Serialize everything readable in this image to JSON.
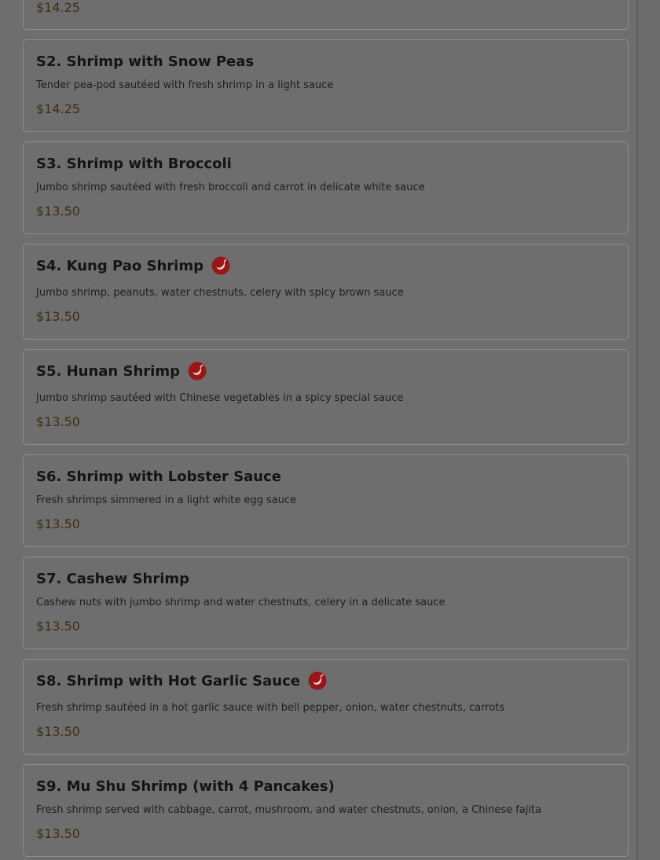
{
  "menu": {
    "items": [
      {
        "price": "$14.25"
      },
      {
        "name": "S2. Shrimp with Snow Peas",
        "description": "Tender pea-pod sautéed with fresh shrimp in a light sauce",
        "price": "$14.25",
        "spicy": false
      },
      {
        "name": "S3. Shrimp with Broccoli",
        "description": "Jumbo shrimp sautéed with fresh broccoli and carrot in delicate white sauce",
        "price": "$13.50",
        "spicy": false
      },
      {
        "name": "S4. Kung Pao Shrimp",
        "description": "Jumbo shrimp, peanuts, water chestnuts, celery with spicy brown sauce",
        "price": "$13.50",
        "spicy": true
      },
      {
        "name": "S5. Hunan Shrimp",
        "description": "Jumbo shrimp sautéed with Chinese vegetables in a spicy special sauce",
        "price": "$13.50",
        "spicy": true
      },
      {
        "name": "S6. Shrimp with Lobster Sauce",
        "description": "Fresh shrimps simmered in a light white egg sauce",
        "price": "$13.50",
        "spicy": false
      },
      {
        "name": "S7. Cashew Shrimp",
        "description": "Cashew nuts with jumbo shrimp and water chestnuts, celery in a delicate sauce",
        "price": "$13.50",
        "spicy": false
      },
      {
        "name": "S8. Shrimp with Hot Garlic Sauce",
        "description": "Fresh shrimp sautéed in a hot garlic sauce with bell pepper, onion, water chestnuts, carrots",
        "price": "$13.50",
        "spicy": true
      },
      {
        "name": "S9. Mu Shu Shrimp (with 4 Pancakes)",
        "description": "Fresh shrimp served with cabbage, carrot, mushroom, and water chestnuts, onion, a Chinese fajita",
        "price": "$13.50",
        "spicy": false
      }
    ],
    "spicy_icon": "chili-pepper-icon",
    "colors": {
      "overlay_bg": "#6e6e6e",
      "spicy_red": "#9b1416",
      "price": "#3f2f0f"
    }
  }
}
